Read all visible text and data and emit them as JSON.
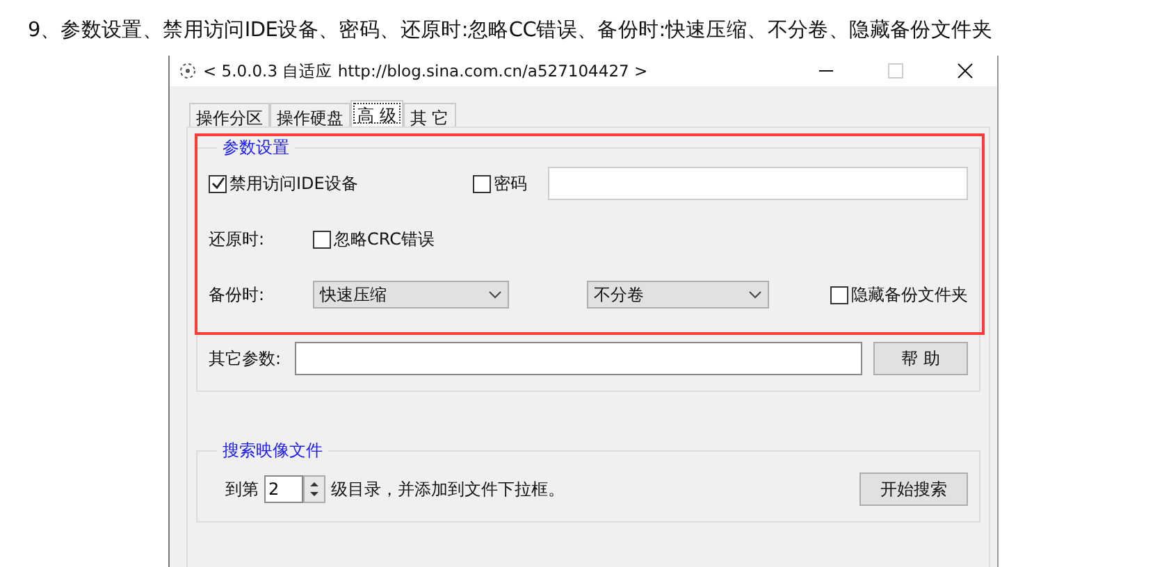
{
  "heading": "9、参数设置、禁用访问IDE设备、密码、还原时:忽略CC错误、备份时:快速压缩、不分卷、隐藏备份文件夹",
  "window": {
    "title": "< 5.0.0.3 自适应 http://blog.sina.com.cn/a527104427 >"
  },
  "tabs": [
    {
      "label": "操作分区",
      "selected": false
    },
    {
      "label": "操作硬盘",
      "selected": false
    },
    {
      "label": "高 级",
      "selected": true
    },
    {
      "label": "其 它",
      "selected": false
    }
  ],
  "params_group": {
    "title": "参数设置",
    "disable_ide": {
      "label": "禁用访问IDE设备",
      "checked": true
    },
    "password": {
      "label": "密码",
      "checked": false
    },
    "restore_label": "还原时:",
    "ignore_crc": {
      "label": "忽略CRC错误",
      "checked": false
    },
    "backup_label": "备份时:",
    "compression": {
      "value": "快速压缩"
    },
    "split": {
      "value": "不分卷"
    },
    "hide_folder": {
      "label": "隐藏备份文件夹",
      "checked": false
    },
    "other_params_label": "其它参数:",
    "help_button": "帮 助"
  },
  "search_group": {
    "title": "搜索映像文件",
    "prefix": "到第",
    "depth": "2",
    "suffix": "级目录，并添加到文件下拉框。",
    "button": "开始搜索"
  }
}
